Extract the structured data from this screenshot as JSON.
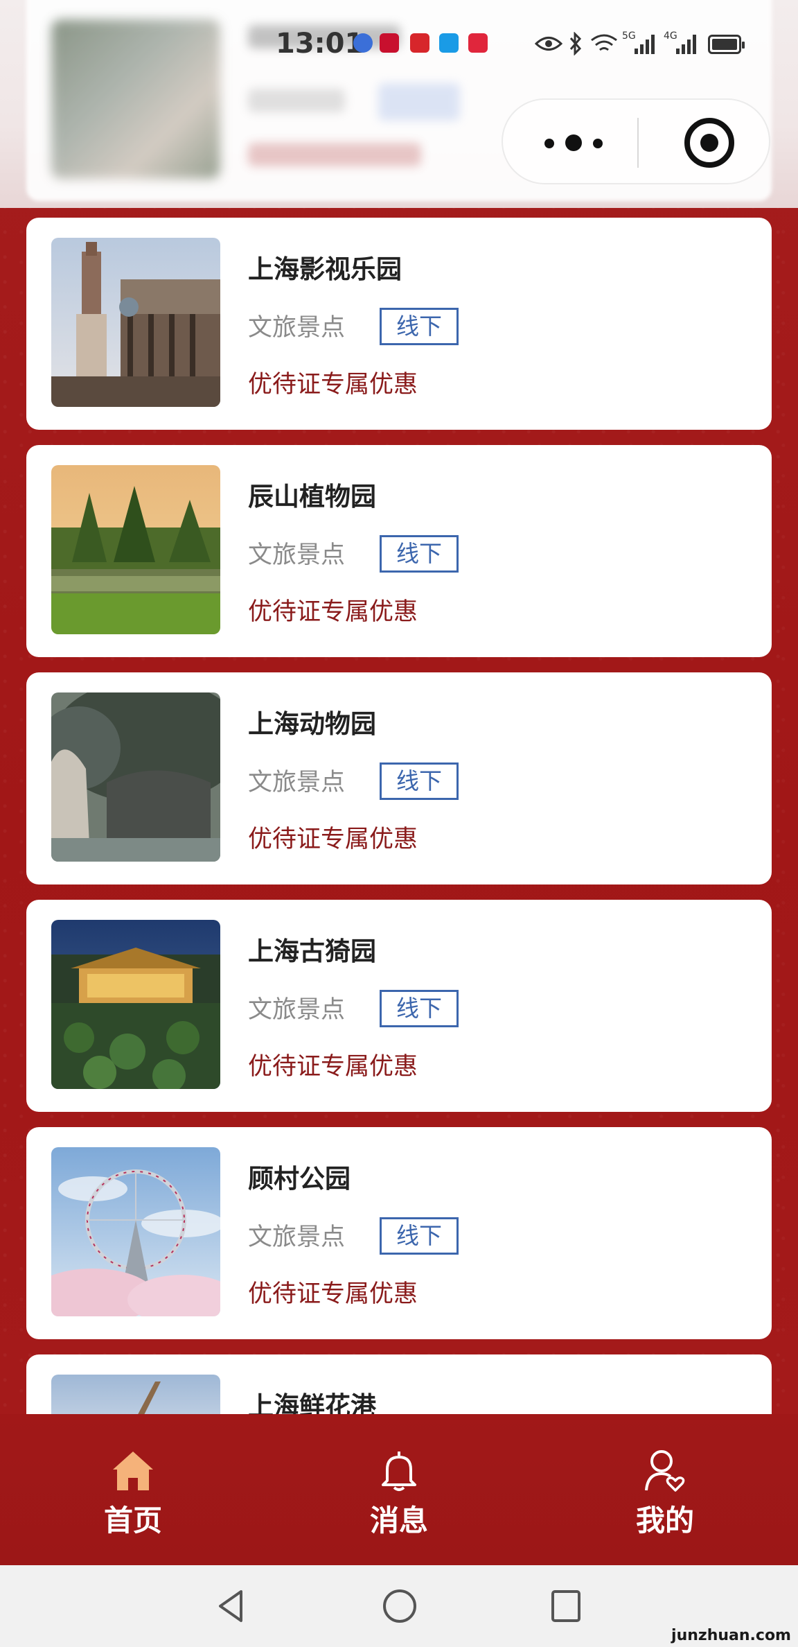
{
  "status_bar": {
    "time": "13:01",
    "network_labels": [
      "5G",
      "4G"
    ],
    "app_icons": [
      "music-icon",
      "tmall-icon",
      "glasses-icon",
      "ele-icon",
      "dongxing-icon"
    ]
  },
  "items": [
    {
      "title": "上海影视乐园",
      "category": "文旅景点",
      "tag": "线下",
      "promo": "优待证专属优惠"
    },
    {
      "title": "辰山植物园",
      "category": "文旅景点",
      "tag": "线下",
      "promo": "优待证专属优惠"
    },
    {
      "title": "上海动物园",
      "category": "文旅景点",
      "tag": "线下",
      "promo": "优待证专属优惠"
    },
    {
      "title": "上海古猗园",
      "category": "文旅景点",
      "tag": "线下",
      "promo": "优待证专属优惠"
    },
    {
      "title": "顾村公园",
      "category": "文旅景点",
      "tag": "线下",
      "promo": "优待证专属优惠"
    },
    {
      "title": "上海鲜花港",
      "category": "",
      "tag": "",
      "promo": ""
    }
  ],
  "tabbar": {
    "home_label": "首页",
    "messages_label": "消息",
    "mine_label": "我的",
    "home_icon": "home-icon",
    "messages_icon": "bell-icon",
    "mine_icon": "user-heart-icon",
    "active_color": "#f5b27a"
  },
  "watermark": "junzhuan.com",
  "colors": {
    "background": "#a51b1b",
    "tag_border": "#3c66ad",
    "promo_text": "#8a1b1b"
  }
}
